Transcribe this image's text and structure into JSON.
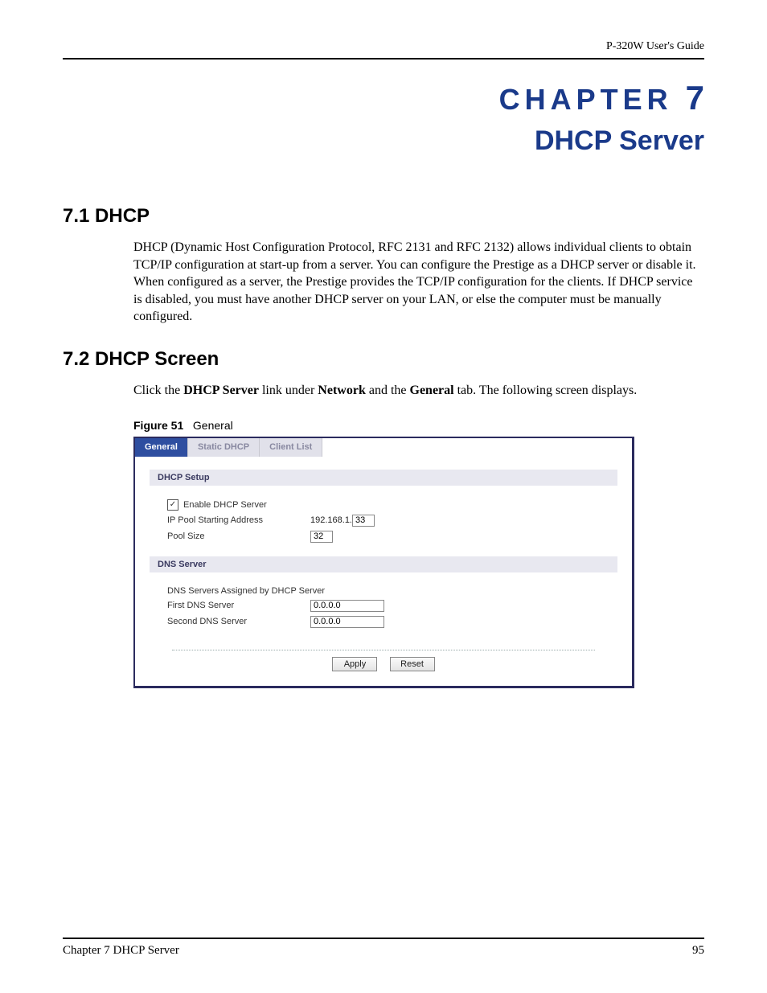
{
  "header": {
    "guide_title": "P-320W User's Guide"
  },
  "chapter": {
    "label": "CHAPTER",
    "number": "7",
    "title": "DHCP Server"
  },
  "sections": {
    "s1": {
      "heading": "7.1  DHCP",
      "paragraph": "DHCP (Dynamic Host Configuration Protocol, RFC 2131 and RFC 2132) allows individual clients to obtain TCP/IP configuration at start-up from a server. You can configure the Prestige as a DHCP server or disable it. When configured as a server, the Prestige provides the TCP/IP configuration for the clients. If DHCP service is disabled, you must have another DHCP server on your LAN, or else the computer must be manually configured."
    },
    "s2": {
      "heading": "7.2  DHCP Screen",
      "intro_pre": "Click the ",
      "intro_b1": "DHCP Server",
      "intro_mid1": " link under ",
      "intro_b2": "Network",
      "intro_mid2": " and the ",
      "intro_b3": "General",
      "intro_post": " tab. The following screen displays."
    }
  },
  "figure": {
    "label": "Figure 51",
    "title": "General",
    "tabs": {
      "general": "General",
      "static": "Static DHCP",
      "client": "Client List"
    },
    "dhcp_setup": {
      "section_title": "DHCP Setup",
      "enable_label": "Enable DHCP Server",
      "ip_pool_label": "IP Pool Starting Address",
      "ip_pool_prefix": "192.168.1.",
      "ip_pool_value": "33",
      "pool_size_label": "Pool Size",
      "pool_size_value": "32"
    },
    "dns_server": {
      "section_title": "DNS Server",
      "assigned_label": "DNS Servers Assigned by DHCP Server",
      "first_label": "First DNS Server",
      "first_value": "0.0.0.0",
      "second_label": "Second DNS Server",
      "second_value": "0.0.0.0"
    },
    "buttons": {
      "apply": "Apply",
      "reset": "Reset"
    }
  },
  "footer": {
    "left": "Chapter 7 DHCP Server",
    "right": "95"
  }
}
